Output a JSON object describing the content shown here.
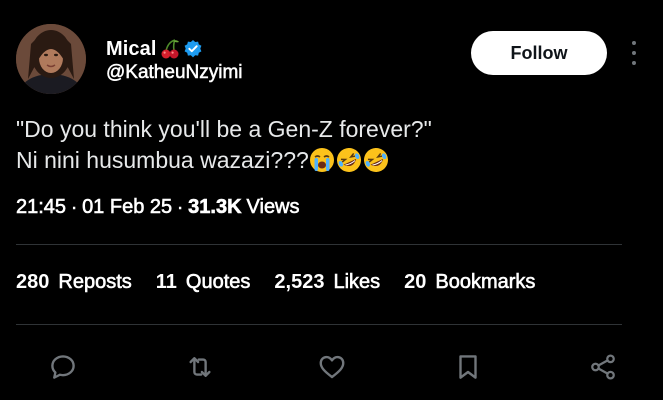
{
  "author": {
    "display_name": "Mical",
    "handle": "@KatheuNzyimi",
    "verified": true,
    "name_emoji": "cherries-icon"
  },
  "header": {
    "follow_label": "Follow",
    "more_icon": "more-vertical-icon"
  },
  "tweet": {
    "line1": "\"Do you think you'll be a Gen-Z forever?\"",
    "line2": "Ni nini husumbua wazazi???",
    "emojis": [
      "loudly-crying-face",
      "rolling-on-floor-laughing",
      "rolling-on-floor-laughing"
    ]
  },
  "meta": {
    "time": "21:45",
    "date": "01 Feb 25",
    "views_count": "31.3K",
    "views_label": "Views",
    "separator": "·"
  },
  "stats": {
    "reposts_count": "280",
    "reposts_label": "Reposts",
    "quotes_count": "11",
    "quotes_label": "Quotes",
    "likes_count": "2,523",
    "likes_label": "Likes",
    "bookmarks_count": "20",
    "bookmarks_label": "Bookmarks"
  },
  "actions": [
    "reply-icon",
    "repost-icon",
    "like-icon",
    "bookmark-icon",
    "share-icon"
  ],
  "colors": {
    "background": "#000000",
    "text": "#e7e9ea",
    "muted": "#71767b",
    "divider": "#2f3336",
    "verified": "#1d9bf0",
    "follow_bg": "#ffffff",
    "follow_text": "#0f1419"
  }
}
